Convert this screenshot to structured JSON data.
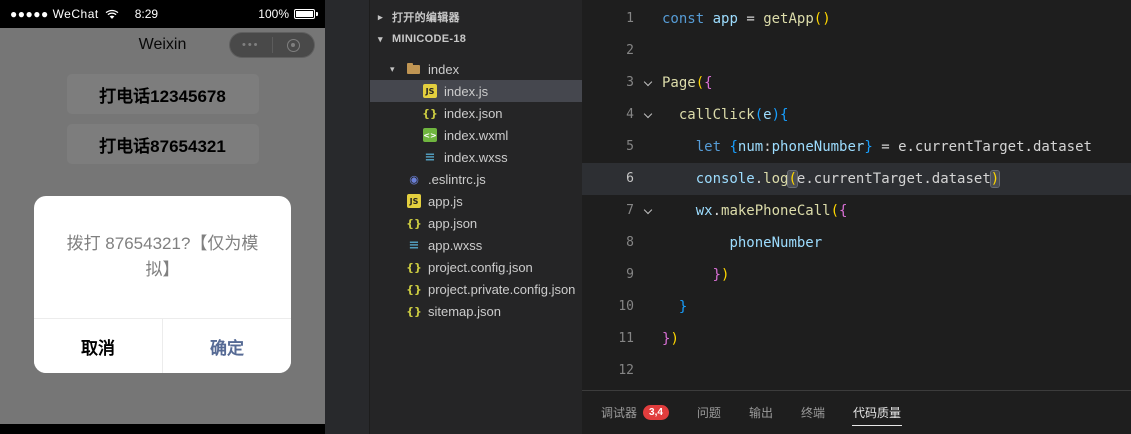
{
  "phone": {
    "status_bar": {
      "carrier": "●●●●● WeChat",
      "time": "8:29",
      "battery": "100%"
    },
    "nav": {
      "title": "Weixin"
    },
    "page": {
      "buttons": [
        "打电话12345678",
        "打电话87654321"
      ]
    },
    "modal": {
      "message": "拨打 87654321?【仅为模拟】",
      "cancel": "取消",
      "confirm": "确定"
    }
  },
  "explorer": {
    "open_editors_label": "打开的编辑器",
    "project_label": "MINICODE-18",
    "tree": [
      {
        "name": "index",
        "icon": "folder",
        "level": 1,
        "kind": "folder",
        "expanded": true
      },
      {
        "name": "index.js",
        "icon": "js",
        "level": 2,
        "selected": true
      },
      {
        "name": "index.json",
        "icon": "json",
        "level": 2
      },
      {
        "name": "index.wxml",
        "icon": "wxml",
        "level": 2
      },
      {
        "name": "index.wxss",
        "icon": "wxss",
        "level": 2
      },
      {
        "name": ".eslintrc.js",
        "icon": "eslint",
        "level": 1
      },
      {
        "name": "app.js",
        "icon": "js",
        "level": 1
      },
      {
        "name": "app.json",
        "icon": "json",
        "level": 1
      },
      {
        "name": "app.wxss",
        "icon": "wxss",
        "level": 1
      },
      {
        "name": "project.config.json",
        "icon": "json",
        "level": 1
      },
      {
        "name": "project.private.config.json",
        "icon": "json",
        "level": 1
      },
      {
        "name": "sitemap.json",
        "icon": "json",
        "level": 1
      }
    ]
  },
  "editor": {
    "lines": [
      {
        "n": "1",
        "tokens": [
          [
            "k",
            "const"
          ],
          [
            "p",
            " "
          ],
          [
            "v",
            "app"
          ],
          [
            "p",
            " = "
          ],
          [
            "f",
            "getApp"
          ],
          [
            "bg",
            "()"
          ]
        ]
      },
      {
        "n": "2",
        "tokens": []
      },
      {
        "n": "3",
        "fold": true,
        "tokens": [
          [
            "f",
            "Page"
          ],
          [
            "bg",
            "("
          ],
          [
            "bp",
            "{"
          ]
        ]
      },
      {
        "n": "4",
        "fold": true,
        "tokens": [
          [
            "p",
            "  "
          ],
          [
            "f",
            "callClick"
          ],
          [
            "bb",
            "("
          ],
          [
            "v",
            "e"
          ],
          [
            "bb",
            ")"
          ],
          [
            "bb",
            "{"
          ]
        ]
      },
      {
        "n": "5",
        "tokens": [
          [
            "p",
            "    "
          ],
          [
            "k",
            "let"
          ],
          [
            "p",
            " "
          ],
          [
            "bb",
            "{"
          ],
          [
            "v",
            "num"
          ],
          [
            "p",
            ":"
          ],
          [
            "v",
            "phoneNumber"
          ],
          [
            "bb",
            "}"
          ],
          [
            "p",
            " = "
          ],
          [
            "p",
            "e.currentTarget.dataset"
          ]
        ]
      },
      {
        "n": "6",
        "current": true,
        "tokens": [
          [
            "p",
            "    "
          ],
          [
            "v",
            "console"
          ],
          [
            "p",
            "."
          ],
          [
            "f",
            "log"
          ],
          [
            "bm",
            "("
          ],
          [
            "p",
            "e.currentTarget.dataset"
          ],
          [
            "bm",
            ")"
          ]
        ]
      },
      {
        "n": "7",
        "fold": true,
        "tokens": [
          [
            "p",
            "    "
          ],
          [
            "v",
            "wx"
          ],
          [
            "p",
            "."
          ],
          [
            "f",
            "makePhoneCall"
          ],
          [
            "bg",
            "("
          ],
          [
            "bp",
            "{"
          ]
        ]
      },
      {
        "n": "8",
        "tokens": [
          [
            "p",
            "        "
          ],
          [
            "v",
            "phoneNumber"
          ]
        ]
      },
      {
        "n": "9",
        "tokens": [
          [
            "p",
            "      "
          ],
          [
            "bp",
            "}"
          ],
          [
            "bg",
            ")"
          ]
        ]
      },
      {
        "n": "10",
        "tokens": [
          [
            "p",
            "  "
          ],
          [
            "bb",
            "}"
          ]
        ]
      },
      {
        "n": "11",
        "tokens": [
          [
            "bp",
            "}"
          ],
          [
            "bg",
            ")"
          ]
        ]
      },
      {
        "n": "12",
        "tokens": []
      }
    ],
    "panel": {
      "tabs": [
        {
          "id": "debugger",
          "label": "调试器",
          "badge": "3,4"
        },
        {
          "id": "problems",
          "label": "问题"
        },
        {
          "id": "output",
          "label": "输出"
        },
        {
          "id": "terminal",
          "label": "终端"
        },
        {
          "id": "code-quality",
          "label": "代码质量",
          "active": true
        }
      ]
    }
  },
  "colors": {
    "modal_confirm_blue": "#576b95",
    "badge_red": "#e13d3d",
    "selected_row": "#45474e",
    "keyword_blue": "#569cd6",
    "function_yellow": "#dcdcaa",
    "variable_blue": "#9cdcfe",
    "bracket_gold": "#ffd700",
    "bracket_pink": "#da70d6",
    "bracket_blue": "#179fff",
    "js_icon_yellow": "#e3cf3e",
    "folder_tan": "#c09553"
  },
  "icons": {
    "wifi": "wifi-icon",
    "battery": "battery-icon",
    "capsule_more": "more-icon",
    "capsule_exit": "exit-icon",
    "fold": "chevron-down-icon"
  }
}
